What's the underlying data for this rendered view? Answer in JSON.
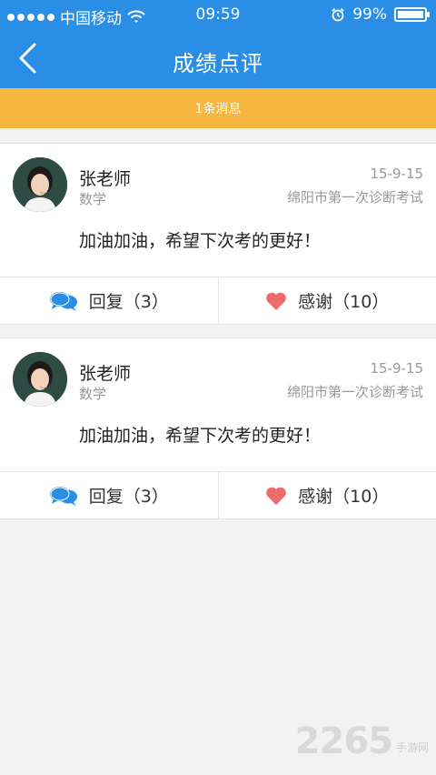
{
  "status_bar": {
    "carrier": "中国移动",
    "time": "09:59",
    "battery": "99%",
    "battery_level": 0.99
  },
  "header": {
    "title": "成绩点评"
  },
  "banner": {
    "text": "1条消息"
  },
  "cards": [
    {
      "name": "张老师",
      "subject": "数学",
      "date": "15-9-15",
      "exam": "绵阳市第一次诊断考试",
      "message": "加油加油，希望下次考的更好！",
      "reply_label": "回复（3）",
      "thank_label": "感谢（10）"
    },
    {
      "name": "张老师",
      "subject": "数学",
      "date": "15-9-15",
      "exam": "绵阳市第一次诊断考试",
      "message": "加油加油，希望下次考的更好！",
      "reply_label": "回复（3）",
      "thank_label": "感谢（10）"
    }
  ],
  "watermark": {
    "main": "2265",
    "sub": "手游网"
  },
  "colors": {
    "primary": "#2a8de6",
    "banner": "#f6b640",
    "heart": "#ee6b6b",
    "reply_icon": "#2a8de6"
  },
  "icons": {
    "back": "chevron-left-icon",
    "reply": "chat-bubbles-icon",
    "thank": "heart-icon",
    "wifi": "wifi-icon",
    "alarm": "alarm-icon",
    "battery": "battery-icon"
  }
}
